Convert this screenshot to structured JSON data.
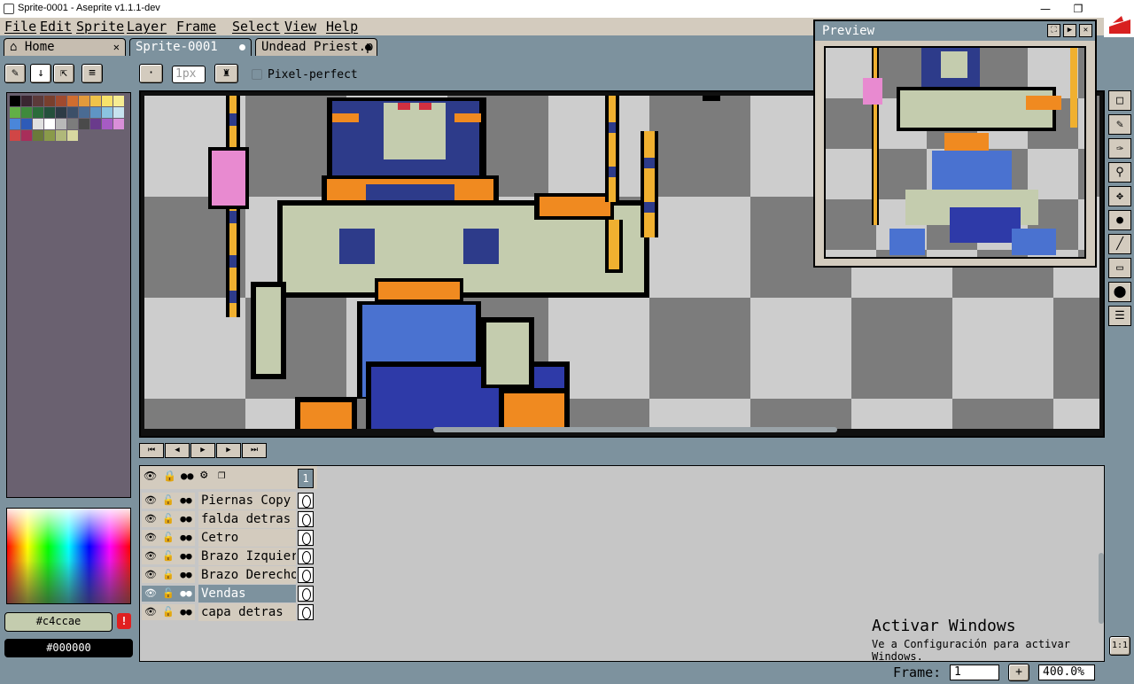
{
  "window": {
    "title": "Sprite-0001 - Aseprite v1.1.1-dev"
  },
  "menu": [
    "File",
    "Edit",
    "Sprite",
    "Layer",
    "Frame",
    "Select",
    "View",
    "Help"
  ],
  "tabs": [
    {
      "label": "Home"
    },
    {
      "label": "Sprite-0001"
    },
    {
      "label": "Undead Priest.p"
    }
  ],
  "toolbar": {
    "brush_size": "1px",
    "pixel_perfect": "Pixel-perfect"
  },
  "palette": [
    "#000000",
    "#3a2631",
    "#5c3a3a",
    "#793f2d",
    "#a04a2f",
    "#d06d2f",
    "#e29a3b",
    "#f0c34a",
    "#f7e26b",
    "#f6ec92",
    "#62b047",
    "#3f8a3c",
    "#2a6b3a",
    "#25503c",
    "#2d3b45",
    "#3c4f68",
    "#4a6b93",
    "#5f95c4",
    "#8bc3e0",
    "#c7e3ef",
    "#4a86d9",
    "#2e5bb8",
    "#e0e0e0",
    "#ffffff",
    "#b8b8b8",
    "#7c7c7c",
    "#4a4a4a",
    "#6a3b8c",
    "#a65bc4",
    "#d98fd9",
    "#d04646",
    "#a82e5a",
    "#6a7a3a",
    "#8a9a4a",
    "#b0b87a",
    "#d8d8a0"
  ],
  "colors": {
    "foreground": "#c4ccae",
    "background": "#000000"
  },
  "preview": {
    "title": "Preview"
  },
  "timeline": {
    "frame_header": "1",
    "layers": [
      {
        "name": "Piernas Copy C",
        "selected": false
      },
      {
        "name": "falda detras",
        "selected": false
      },
      {
        "name": "Cetro",
        "selected": false
      },
      {
        "name": "Brazo Izquierd",
        "selected": false
      },
      {
        "name": "Brazo Derecho",
        "selected": false
      },
      {
        "name": "Vendas",
        "selected": true
      },
      {
        "name": "capa detras",
        "selected": false
      }
    ]
  },
  "watermark": {
    "title": "Activar Windows",
    "subtitle": "Ve a Configuración para activar Windows."
  },
  "status": {
    "frame_label": "Frame:",
    "frame_value": "1",
    "zoom": "400.0%",
    "add": "+"
  }
}
